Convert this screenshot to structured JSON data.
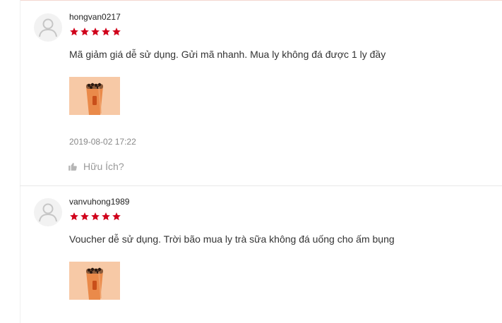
{
  "reviews": [
    {
      "username": "hongvan0217",
      "rating": 5,
      "comment": "Mã giảm giá dễ sử dụng. Gửi mã nhanh. Mua ly không đá được 1 ly đầy",
      "timestamp": "2019-08-02 17:22",
      "helpful_label": "Hữu Ích?"
    },
    {
      "username": "vanvuhong1989",
      "rating": 5,
      "comment": "Voucher dễ sử dụng. Trời bão mua ly trà sữa không đá uống cho ấm bụng"
    }
  ],
  "icons": {
    "avatar": "user-avatar-placeholder-icon",
    "star": "star-filled-icon",
    "helpful": "thumbs-up-icon",
    "photo": "bubble-milk-tea-photo"
  },
  "colors": {
    "star": "#d0011b",
    "avatar_bg": "#f2f2f2",
    "avatar_fg": "#c6c6c6",
    "photo_bg": "#f7c9a6",
    "drink": "#ea8a4a",
    "muted_text": "#888888"
  }
}
